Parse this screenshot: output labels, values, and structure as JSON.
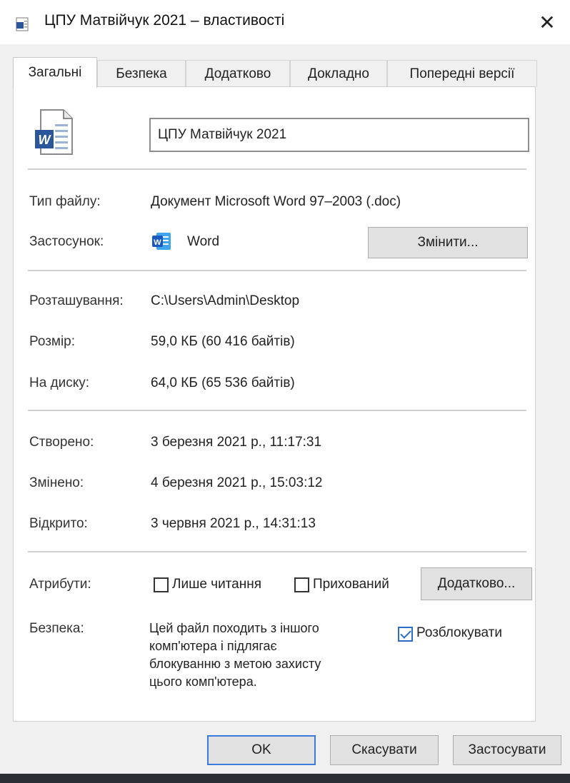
{
  "window": {
    "title": "ЦПУ Матвійчук 2021 – властивості",
    "close_glyph": "✕"
  },
  "tabs": [
    {
      "label": "Загальні",
      "active": true
    },
    {
      "label": "Безпека",
      "active": false
    },
    {
      "label": "Додатково",
      "active": false
    },
    {
      "label": "Докладно",
      "active": false
    },
    {
      "label": "Попередні версії",
      "active": false
    }
  ],
  "general": {
    "file_icon": "word-document-icon",
    "name_value": "ЦПУ Матвійчук 2021",
    "file_type_label": "Тип файлу:",
    "file_type_value": "Документ Microsoft Word 97–2003 (.doc)",
    "app_label": "Застосунок:",
    "app_icon": "word-app-icon",
    "app_value": "Word",
    "change_button": "Змінити...",
    "location_label": "Розташування:",
    "location_value": "C:\\Users\\Admin\\Desktop",
    "size_label": "Розмір:",
    "size_value": "59,0 КБ (60 416 байтів)",
    "disk_label": "На диску:",
    "disk_value": "64,0 КБ (65 536 байтів)",
    "created_label": "Створено:",
    "created_value": "3 березня 2021 р., 11:17:31",
    "modified_label": "Змінено:",
    "modified_value": "4 березня 2021 р., 15:03:12",
    "accessed_label": "Відкрито:",
    "accessed_value": "3 червня 2021 р., 14:31:13",
    "attributes_label": "Атрибути:",
    "readonly_label": "Лише читання",
    "readonly_checked": false,
    "hidden_label": "Прихований",
    "hidden_checked": false,
    "advanced_button": "Додатково...",
    "security_label": "Безпека:",
    "security_lines": [
      "Цей файл походить з іншого",
      "комп'ютера і підлягає",
      "блокуванню з метою захисту",
      "цього комп'ютера."
    ],
    "unblock_label": "Розблокувати",
    "unblock_checked": true
  },
  "footer": {
    "ok": "OK",
    "cancel": "Скасувати",
    "apply": "Застосувати"
  },
  "colors": {
    "word_blue": "#2b579a",
    "accent": "#3b7ad9"
  }
}
